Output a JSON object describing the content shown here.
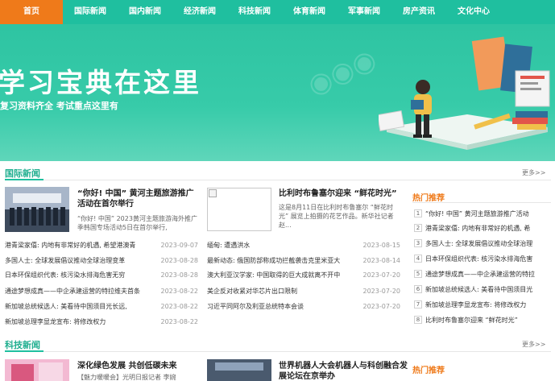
{
  "nav": {
    "items": [
      {
        "label": "首页",
        "active": true
      },
      {
        "label": "国际新闻"
      },
      {
        "label": "国内新闻"
      },
      {
        "label": "经济新闻"
      },
      {
        "label": "科技新闻"
      },
      {
        "label": "体育新闻"
      },
      {
        "label": "军事新闻"
      },
      {
        "label": "房产资讯"
      },
      {
        "label": "文化中心"
      }
    ]
  },
  "banner": {
    "title": "学习宝典在这里",
    "subtitle": "复习资料齐全 考试重点这里有"
  },
  "intl": {
    "title": "国际新闻",
    "more": "更多>>",
    "feature1": {
      "title": "“你好! 中国” 黄河主题旅游推广活动在首尔举行",
      "desc": "“你好! 中国” 2023黄河主题旅游海外推广季韩国专场活动5日在首尔举行,"
    },
    "feature2": {
      "title": "比利时布鲁塞尔迎来 “鲜花时光”",
      "desc": "这是8月11日在比利时布鲁塞尔 “鲜花时光” 展览上拍摄的花艺作品。新华社记者赵..."
    },
    "list_left": [
      {
        "title": "港青梁家僖: 内地有非常好的机遇, 希望港澳青",
        "date": "2023-09-07"
      },
      {
        "title": "多国人士: 全球发展倡议推动全球治理变革",
        "date": "2023-08-28"
      },
      {
        "title": "日本环保组织代表: 核污染水排海危害无穷",
        "date": "2023-08-28"
      },
      {
        "title": "通途梦想成真——中企承建运营的特拉维夫首条",
        "date": "2023-08-22"
      },
      {
        "title": "新加坡总统候选人: 美看待中国须目光长远,",
        "date": "2023-08-22"
      },
      {
        "title": "新加坡总理李显龙宣布: 将修改权力",
        "date": "2023-08-22"
      }
    ],
    "list_right": [
      {
        "title": "缅甸: 遭遇洪水",
        "date": "2023-08-15"
      },
      {
        "title": "最新动态: 俄国防部称成功拦截袭击克里米亚大",
        "date": "2023-08-14"
      },
      {
        "title": "澳大利亚汉学家: 中国取得的巨大成就离不开中",
        "date": "2023-07-20"
      },
      {
        "title": "美企反对收紧对华芯片出口限制",
        "date": "2023-07-20"
      },
      {
        "title": "习近平同阿尔及利亚总统特本会谈",
        "date": "2023-07-20"
      }
    ],
    "hot": {
      "title": "热门推荐",
      "items": [
        "“你好! 中国” 黄河主题旅游推广活动",
        "港青梁家僖: 内地有非常好的机遇, 希",
        "多国人士: 全球发展倡议推动全球治理",
        "日本环保组织代表: 核污染水排海危害",
        "通途梦想成真——中企承建运营的特拉",
        "新加坡总统候选人: 美看待中国须目光",
        "新加坡总理李显龙宣布: 将修改权力",
        "比利时布鲁塞尔迎来 “鲜花时光”"
      ]
    }
  },
  "tech": {
    "title": "科技新闻",
    "more": "更多>>",
    "feature1": {
      "title": "深化绿色发展 共创低碳未来",
      "desc": "【魅力暖暖会】光明日报记者 李婉"
    },
    "feature2": {
      "title": "世界机器人大会机器人与科创融合发展论坛在京举办"
    },
    "hot_title": "热门推荐"
  }
}
